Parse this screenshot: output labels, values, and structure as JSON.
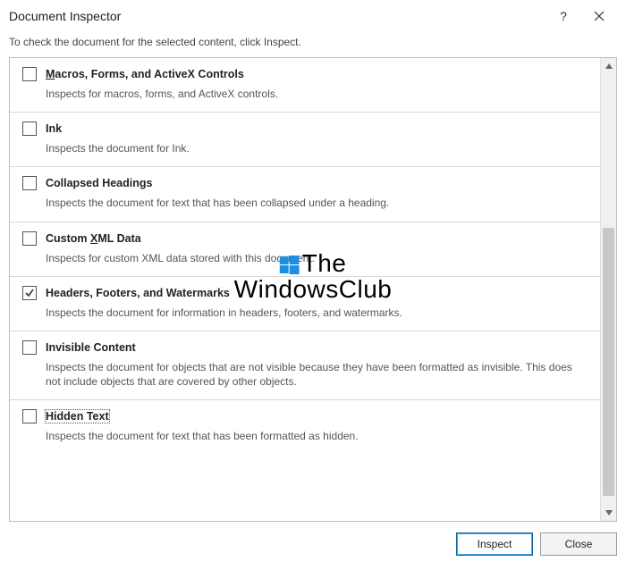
{
  "dialog": {
    "title": "Document Inspector",
    "instruction": "To check the document for the selected content, click Inspect."
  },
  "items": [
    {
      "title_pre": "",
      "title_ul": "M",
      "title_post": "acros, Forms, and ActiveX Controls",
      "desc": "Inspects for macros, forms, and ActiveX controls.",
      "checked": false
    },
    {
      "title_pre": "Ink",
      "title_ul": "",
      "title_post": "",
      "desc": "Inspects the document for Ink.",
      "checked": false
    },
    {
      "title_pre": "Collapsed Headings",
      "title_ul": "",
      "title_post": "",
      "desc": "Inspects the document for text that has been collapsed under a heading.",
      "checked": false
    },
    {
      "title_pre": "Custom ",
      "title_ul": "X",
      "title_post": "ML Data",
      "desc": "Inspects for custom XML data stored with this document.",
      "checked": false
    },
    {
      "title_pre": "Headers, Footers, and Watermarks",
      "title_ul": "",
      "title_post": "",
      "desc": "Inspects the document for information in headers, footers, and watermarks.",
      "checked": true
    },
    {
      "title_pre": "Invisible Content",
      "title_ul": "",
      "title_post": "",
      "desc": "Inspects the document for objects that are not visible because they have been formatted as invisible. This does not include objects that are covered by other objects.",
      "checked": false
    },
    {
      "title_pre": "Hidden Text",
      "title_ul": "",
      "title_post": "",
      "desc": "Inspects the document for text that has been formatted as hidden.",
      "checked": false,
      "focused": true
    }
  ],
  "buttons": {
    "inspect": "Inspect",
    "close": "Close",
    "close_ul": "C",
    "close_post": "lose"
  },
  "watermark": {
    "line1": "The",
    "line2": "WindowsClub"
  }
}
